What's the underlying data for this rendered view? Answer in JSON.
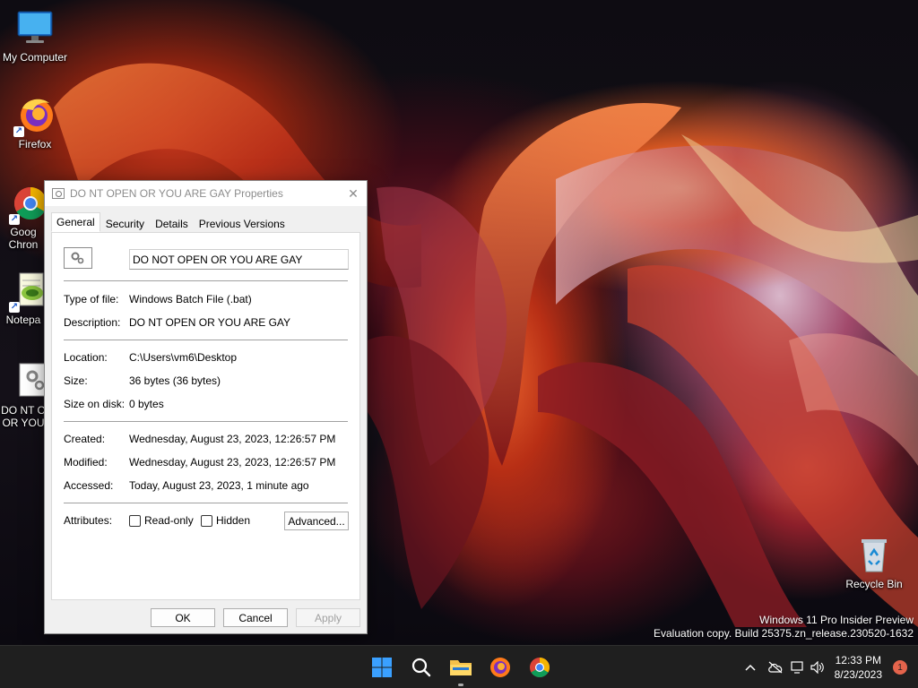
{
  "desktop": {
    "icons": [
      {
        "label": "My Computer"
      },
      {
        "label": "Firefox"
      },
      {
        "label": "Goog Chron"
      },
      {
        "label": "Notepa"
      },
      {
        "label": "DO NT O OR YOU"
      },
      {
        "label": "Recycle Bin"
      }
    ],
    "watermark": {
      "line1": "Windows 11 Pro Insider Preview",
      "line2": "Evaluation copy. Build 25375.zn_release.230520-1632"
    }
  },
  "dialog": {
    "title": "DO NT OPEN OR YOU ARE GAY Properties",
    "close_glyph": "✕",
    "tabs": [
      {
        "label": "General",
        "active": true
      },
      {
        "label": "Security",
        "active": false
      },
      {
        "label": "Details",
        "active": false
      },
      {
        "label": "Previous Versions",
        "active": false
      }
    ],
    "filename": "DO NOT OPEN OR YOU ARE GAY",
    "props": {
      "type_label": "Type of file:",
      "type_value": "Windows Batch File (.bat)",
      "desc_label": "Description:",
      "desc_value": "DO NT OPEN OR YOU ARE GAY",
      "location_label": "Location:",
      "location_value": "C:\\Users\\vm6\\Desktop",
      "size_label": "Size:",
      "size_value": "36 bytes (36 bytes)",
      "disk_label": "Size on disk:",
      "disk_value": "0 bytes",
      "created_label": "Created:",
      "created_value": "Wednesday, August 23, 2023, 12:26:57 PM",
      "modified_label": "Modified:",
      "modified_value": "Wednesday, August 23, 2023, 12:26:57 PM",
      "accessed_label": "Accessed:",
      "accessed_value": "Today, August 23, 2023, 1 minute ago",
      "attributes_label": "Attributes:"
    },
    "attributes": {
      "readonly_label": "Read-only",
      "readonly_checked": false,
      "hidden_label": "Hidden",
      "hidden_checked": false,
      "advanced_label": "Advanced..."
    },
    "buttons": {
      "ok": "OK",
      "cancel": "Cancel",
      "apply": "Apply"
    }
  },
  "taskbar": {
    "apps": [
      {
        "icon": "windows-start-icon"
      },
      {
        "icon": "search-icon"
      },
      {
        "icon": "file-explorer-icon",
        "running": true
      },
      {
        "icon": "firefox-icon"
      },
      {
        "icon": "chrome-icon"
      }
    ],
    "tray": {
      "chevron": "^",
      "time": "12:33 PM",
      "date": "8/23/2023",
      "notification_count": "1"
    }
  }
}
